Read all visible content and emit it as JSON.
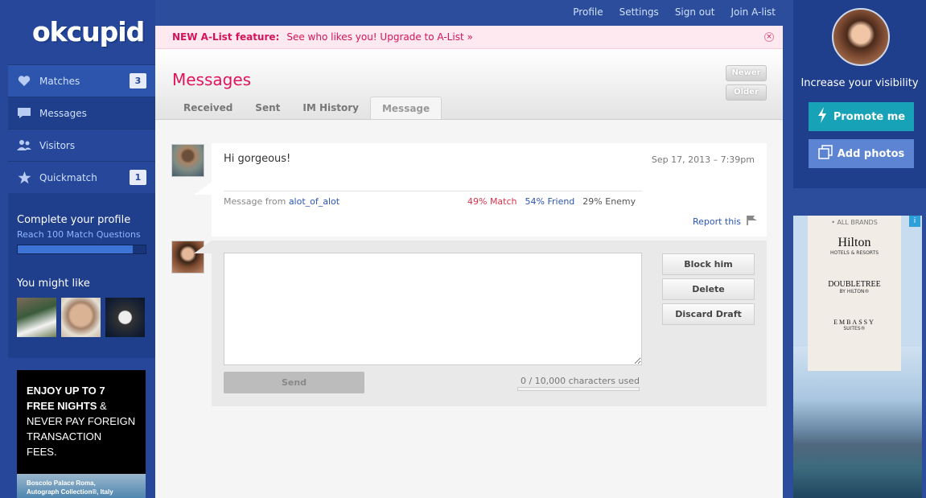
{
  "brand": {
    "logo_text": "okcupid"
  },
  "top_links": [
    "Profile",
    "Settings",
    "Sign out",
    "Join A-list"
  ],
  "sidebar": {
    "items": [
      {
        "label": "Matches",
        "icon": "heart-icon",
        "count": "3"
      },
      {
        "label": "Messages",
        "icon": "chat-bubble-icon",
        "count": ""
      },
      {
        "label": "Visitors",
        "icon": "people-icon",
        "count": ""
      },
      {
        "label": "Quickmatch",
        "icon": "star-icon",
        "count": "1"
      }
    ],
    "complete_profile": {
      "title": "Complete your profile",
      "link": "Reach 100 Match Questions",
      "progress": 0.9
    },
    "you_might_like": {
      "title": "You might like"
    }
  },
  "ad_left": {
    "line1": "ENJOY UP TO 7",
    "line2": "FREE NIGHTS",
    "line2b": " &",
    "line3": "NEVER PAY FOREIGN",
    "line4": "TRANSACTION",
    "line5": "FEES.",
    "caption1": "Boscolo Palace Roma,",
    "caption2": "Autograph Collection®, Italy"
  },
  "notice": {
    "label": "NEW A-List feature:",
    "text": "See who likes you! Upgrade to A-List »",
    "close": "×"
  },
  "messages": {
    "title": "Messages",
    "tabs": [
      "Received",
      "Sent",
      "IM History",
      "Message"
    ],
    "active_tab": "Message",
    "pager": {
      "newer": "Newer",
      "older": "Older"
    }
  },
  "message": {
    "body": "Hi gorgeous!",
    "date": "Sep 17, 2013 – 7:39pm",
    "from_prefix": "Message from ",
    "from_user": "alot_of_alot",
    "match": "49% Match",
    "friend": "54% Friend",
    "enemy": "29% Enemy",
    "report": "Report this"
  },
  "reply": {
    "placeholder": "",
    "send": "Send",
    "counter": "0 / 10,000 characters used",
    "actions": [
      "Block him",
      "Delete",
      "Discard Draft"
    ]
  },
  "right": {
    "visibility": "Increase your visibility",
    "promote": "Promote me",
    "add_photos": "Add photos"
  },
  "ad_right": {
    "all_brands": "• ALL BRANDS",
    "hilton": "Hilton",
    "hilton_sub": "HOTELS & RESORTS",
    "doubletree": "DOUBLETREE",
    "doubletree_sub": "BY HILTON®",
    "embassy": "EMBASSY",
    "embassy_suites": "SUITES®",
    "adchoices": "i"
  },
  "colors": {
    "brand_blue": "#26479a",
    "title_pink": "#e0145c",
    "promote_teal": "#17a2b8",
    "photos_blue": "#5c84d3"
  }
}
